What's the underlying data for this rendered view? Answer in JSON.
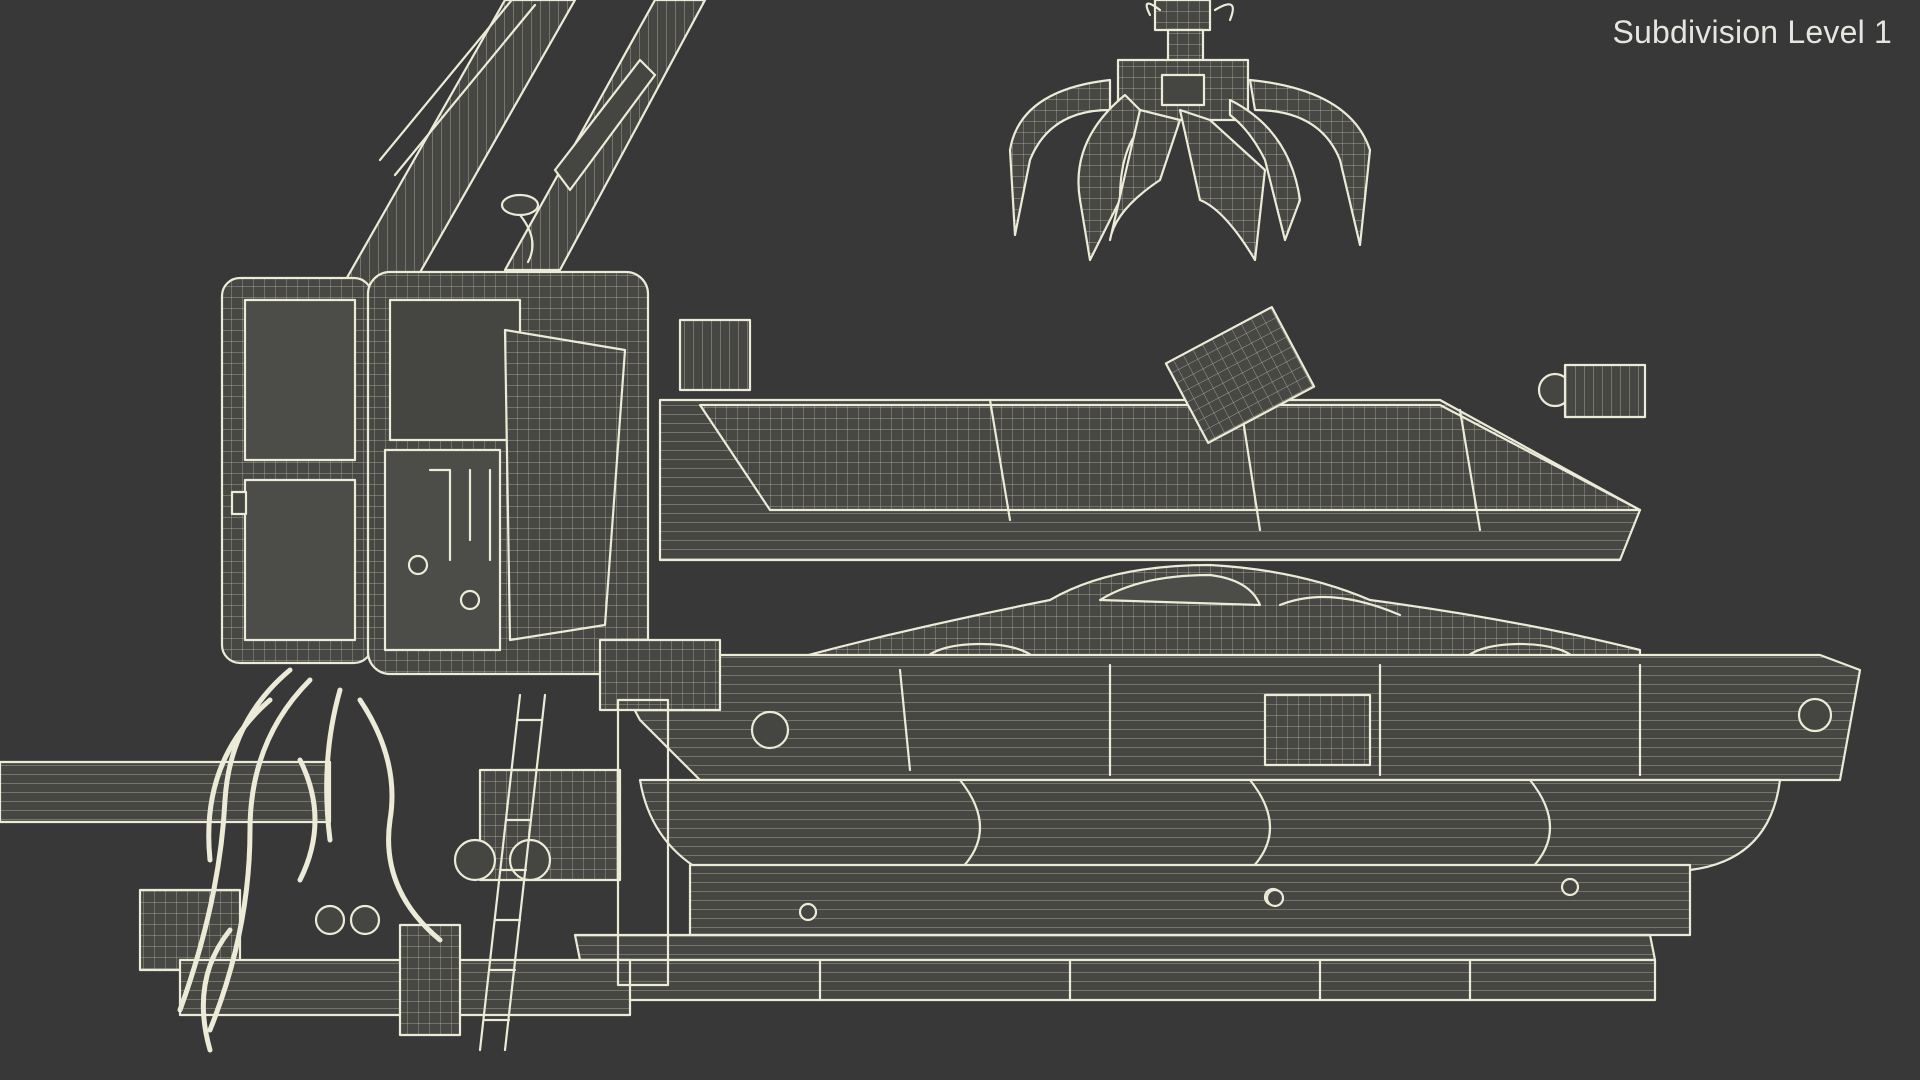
{
  "viewport_label": "Subdivision Level 1",
  "colors": {
    "background": "#383838",
    "wireframe": "#ecebd8",
    "surface": "#454542",
    "label_text": "#e6e6e0"
  },
  "scene_parts": [
    "crane-boom",
    "grapple-claw",
    "operator-cabin",
    "press-lid",
    "crushed-car",
    "press-chamber",
    "base-frame",
    "hydraulic-hoses",
    "ladder",
    "side-pipe"
  ]
}
